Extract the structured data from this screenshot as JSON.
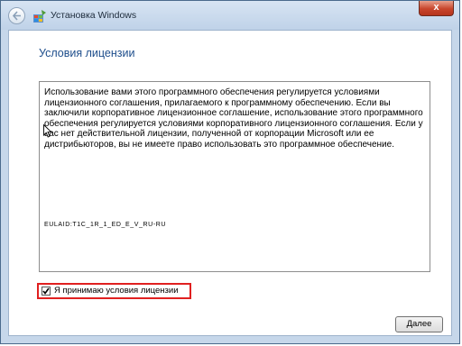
{
  "window": {
    "title": "Установка Windows",
    "close_label": "x"
  },
  "page": {
    "heading": "Условия лицензии"
  },
  "license": {
    "text": "Использование вами этого программного обеспечения регулируется условиями лицензионного соглашения, прилагаемого к программному обеспечению. Если вы заключили корпоративное лицензионное соглашение, использование этого программного обеспечения регулируется условиями корпоративного лицензионного соглашения. Если у вас нет действительной лицензии, полученной от корпорации Microsoft или ее дистрибьюторов, вы не имеете право использовать это программное обеспечение.",
    "eula_id": "EULAID:T1C_1R_1_ED_E_V_RU-RU"
  },
  "accept": {
    "label": "Я принимаю условия лицензии",
    "checked": true
  },
  "footer": {
    "next_label": "Далее"
  },
  "colors": {
    "heading": "#1e4e8c",
    "highlight_border": "#e02020",
    "close_button": "#c8452c"
  },
  "icons": [
    "back-arrow-icon",
    "windows-setup-icon",
    "close-icon",
    "checkmark-icon",
    "mouse-cursor-icon"
  ]
}
